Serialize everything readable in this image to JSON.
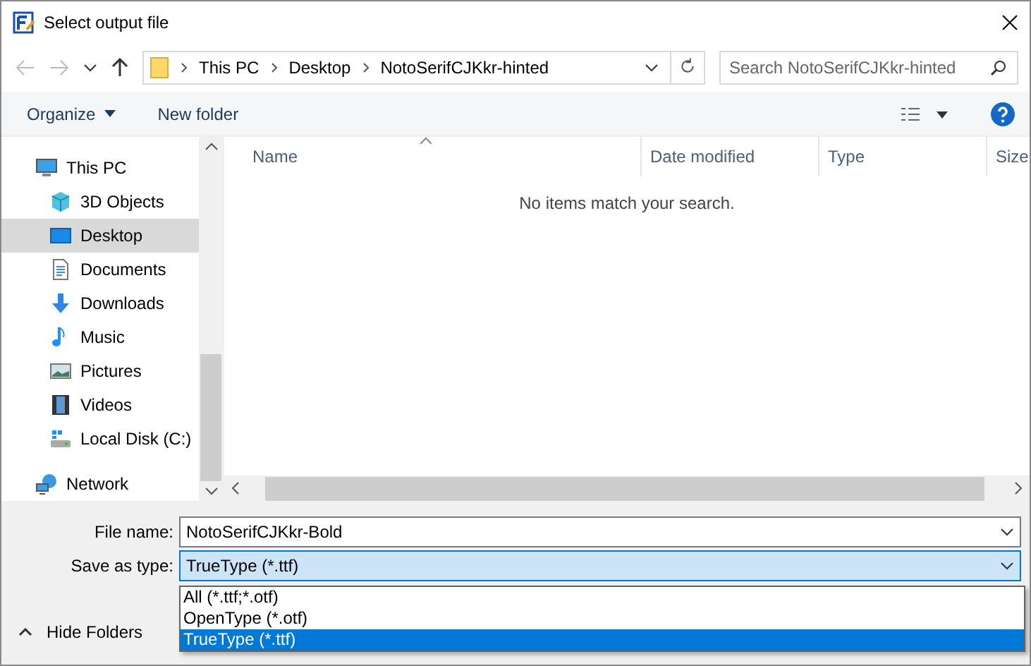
{
  "window": {
    "title": "Select output file"
  },
  "address_bar": {
    "path": [
      {
        "label": "This PC"
      },
      {
        "label": "Desktop"
      },
      {
        "label": "NotoSerifCJKkr-hinted"
      }
    ]
  },
  "search": {
    "placeholder": "Search NotoSerifCJKkr-hinted"
  },
  "toolbar": {
    "organize": "Organize",
    "new_folder": "New folder"
  },
  "sidebar": {
    "items": [
      {
        "label": "This PC",
        "kind": "pc",
        "selected": false,
        "children": [
          {
            "label": "3D Objects",
            "kind": "objects",
            "selected": false
          },
          {
            "label": "Desktop",
            "kind": "desktop",
            "selected": true
          },
          {
            "label": "Documents",
            "kind": "documents",
            "selected": false
          },
          {
            "label": "Downloads",
            "kind": "downloads",
            "selected": false
          },
          {
            "label": "Music",
            "kind": "music",
            "selected": false
          },
          {
            "label": "Pictures",
            "kind": "pictures",
            "selected": false
          },
          {
            "label": "Videos",
            "kind": "videos",
            "selected": false
          },
          {
            "label": "Local Disk (C:)",
            "kind": "disk",
            "selected": false
          }
        ]
      },
      {
        "label": "Network",
        "kind": "network",
        "selected": false
      }
    ]
  },
  "table": {
    "columns": [
      "Name",
      "Date modified",
      "Type",
      "Size"
    ],
    "empty_message": "No items match your search."
  },
  "form": {
    "file_name_label": "File name:",
    "file_name": "NotoSerifCJKkr-Bold",
    "type_label": "Save as type:",
    "type_value": "TrueType (*.ttf)",
    "type_options": [
      {
        "label": "All (*.ttf;*.otf)",
        "selected": false
      },
      {
        "label": "OpenType (*.otf)",
        "selected": false
      },
      {
        "label": "TrueType (*.ttf)",
        "selected": true
      }
    ]
  },
  "hide_folders": "Hide Folders"
}
